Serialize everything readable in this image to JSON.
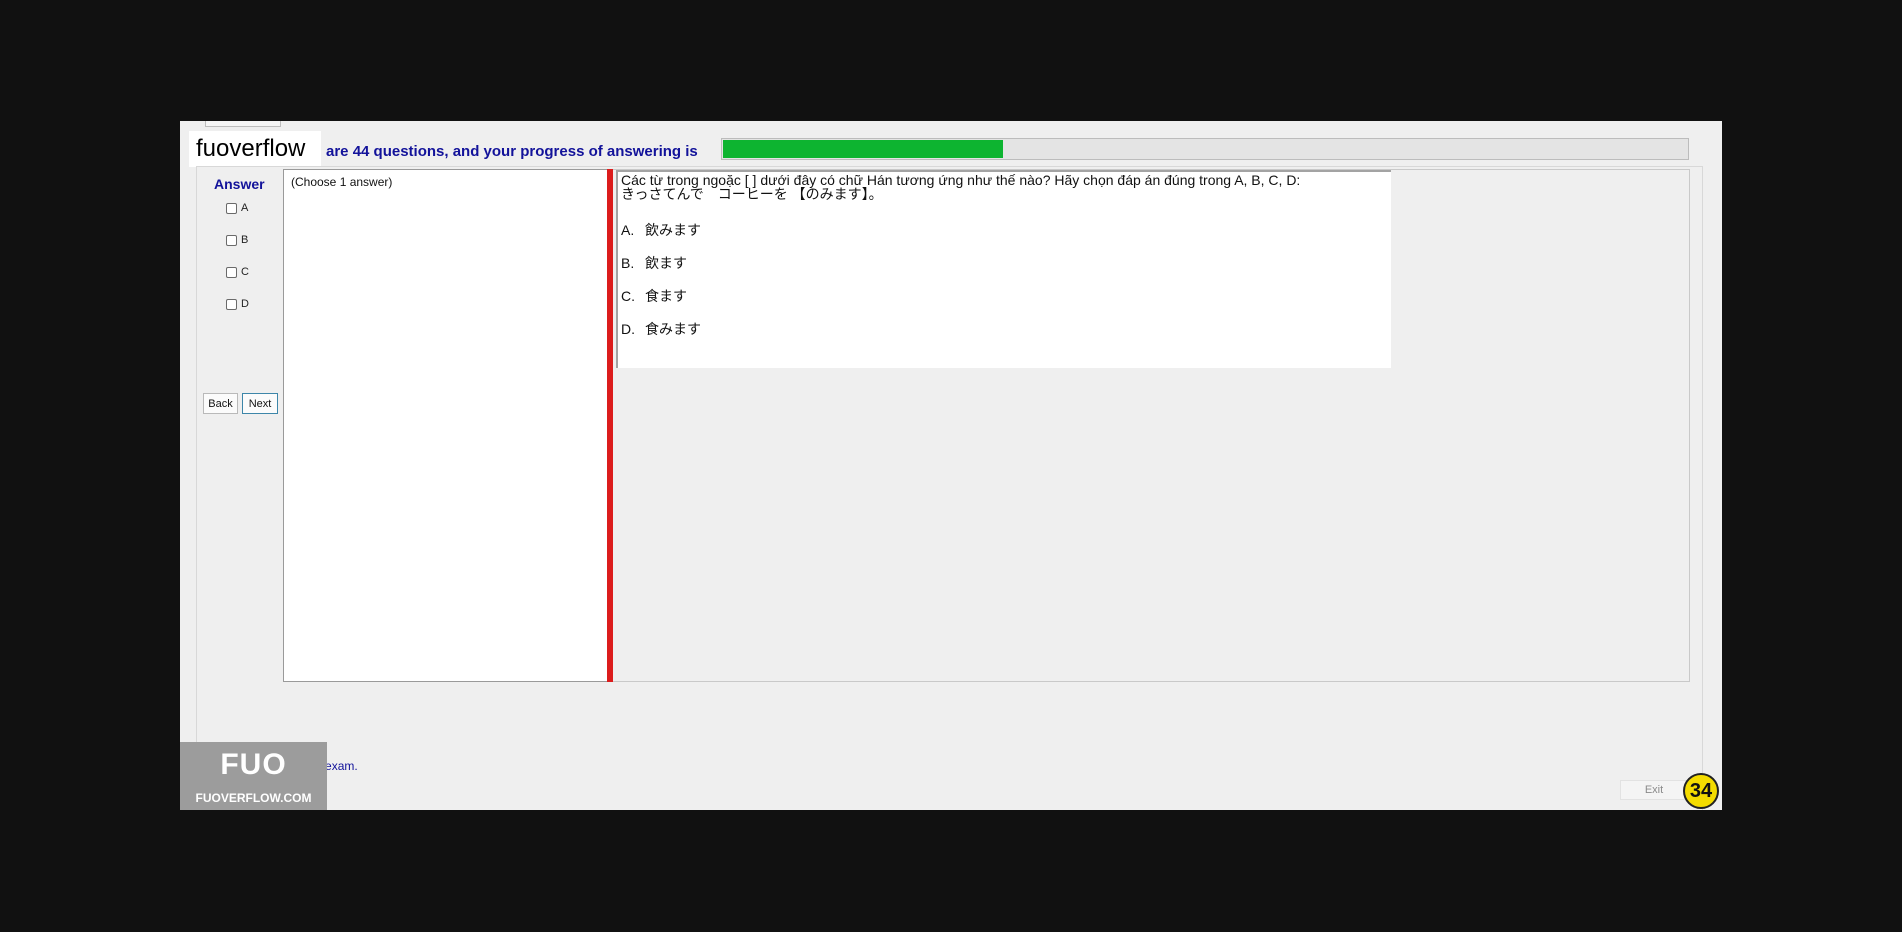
{
  "brand": {
    "name": "fuoverflow"
  },
  "progress": {
    "text": "are 44 questions, and your progress of answering is",
    "value": 0.29,
    "fill_color": "#0db430"
  },
  "answer_panel": {
    "title": "Answer",
    "options": [
      "A",
      "B",
      "C",
      "D"
    ],
    "back_label": "Back",
    "next_label": "Next"
  },
  "choose": {
    "label": "(Choose 1 answer)"
  },
  "question": {
    "prompt": "Các từ trong ngoặc [   ]  dưới đây có chữ Hán tương ứng như thế nào? Hãy chọn đáp án đúng trong A, B, C, D:",
    "sentence": "きっさてんで　コーヒーを 【のみます】。",
    "choices": [
      {
        "letter": "A.",
        "text": "飲みます"
      },
      {
        "letter": "B.",
        "text": "飲ます"
      },
      {
        "letter": "C.",
        "text": "食ます"
      },
      {
        "letter": "D.",
        "text": "食みます"
      }
    ]
  },
  "footer": {
    "finish_label": "I want to finish the exam.",
    "exit_label": "Exit",
    "badge": "34"
  },
  "watermark_logo": {
    "mark": "FUO",
    "site": "FUOVERFLOW.COM"
  },
  "colors": {
    "accent_text": "#12129a",
    "splitter": "#dc1c1c",
    "badge": "#f4dc00"
  }
}
